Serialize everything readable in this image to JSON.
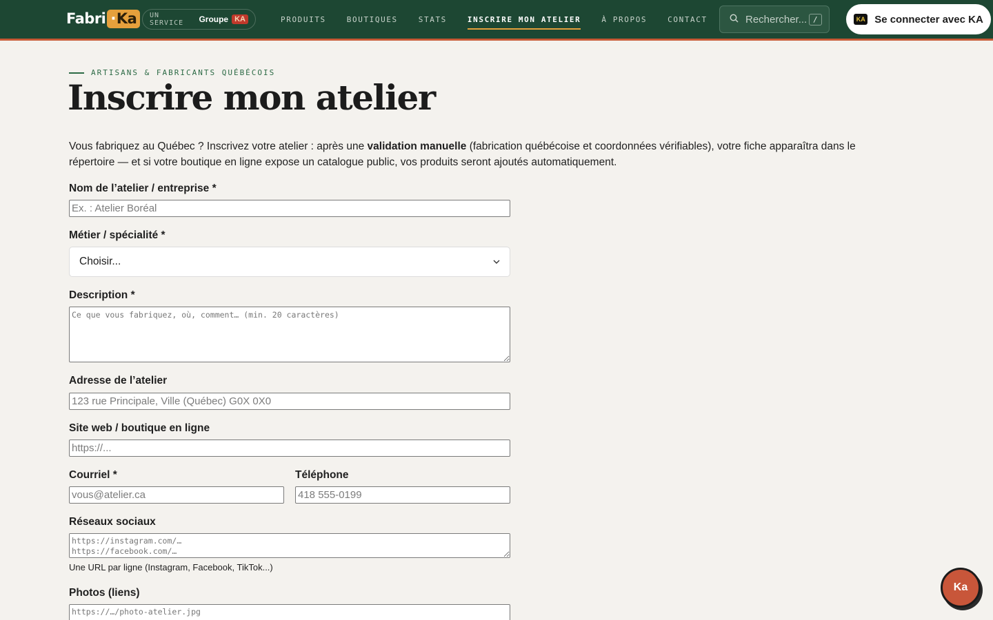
{
  "header": {
    "logo": {
      "text": "Fabri",
      "ka": "Ka"
    },
    "service": {
      "prefix": "UN SERVICE",
      "group": "Groupe",
      "badge": "KA"
    },
    "nav": [
      {
        "label": "PRODUITS"
      },
      {
        "label": "BOUTIQUES"
      },
      {
        "label": "STATS"
      },
      {
        "label": "INSCRIRE MON ATELIER",
        "active": true
      },
      {
        "label": "À PROPOS"
      },
      {
        "label": "CONTACT"
      }
    ],
    "search": {
      "placeholder": "Rechercher...",
      "shortcut": "/"
    },
    "login": {
      "chip": "KA",
      "label": "Se connecter avec KA"
    }
  },
  "page": {
    "eyebrow": "ARTISANS & FABRICANTS QUÉBÉCOIS",
    "title": "Inscrire mon atelier",
    "intro_before": "Vous fabriquez au Québec ? Inscrivez votre atelier : après une ",
    "intro_bold": "validation manuelle",
    "intro_after": " (fabrication québécoise et coordonnées vérifiables), votre fiche apparaîtra dans le répertoire — et si votre boutique en ligne expose un catalogue public, vos produits seront ajoutés automatiquement."
  },
  "form": {
    "name": {
      "label": "Nom de l’atelier / entreprise *",
      "placeholder": "Ex. : Atelier Boréal"
    },
    "trade": {
      "label": "Métier / spécialité *",
      "value": "Choisir..."
    },
    "description": {
      "label": "Description *",
      "placeholder": "Ce que vous fabriquez, où, comment… (min. 20 caractères)"
    },
    "address": {
      "label": "Adresse de l’atelier",
      "placeholder": "123 rue Principale, Ville (Québec) G0X 0X0"
    },
    "website": {
      "label": "Site web / boutique en ligne",
      "placeholder": "https://..."
    },
    "email": {
      "label": "Courriel *",
      "placeholder": "vous@atelier.ca"
    },
    "phone": {
      "label": "Téléphone",
      "placeholder": "418 555-0199"
    },
    "social": {
      "label": "Réseaux sociaux",
      "placeholder": "https://instagram.com/…\nhttps://facebook.com/…",
      "hint": "Une URL par ligne (Instagram, Facebook, TikTok...)"
    },
    "photos": {
      "label": "Photos (liens)",
      "placeholder": "https://…/photo-atelier.jpg"
    }
  },
  "fab": {
    "label": "Ka"
  },
  "colors": {
    "header_bg": "#1d4733",
    "accent": "#c85a36",
    "gold": "#e5a03c",
    "page_bg": "#f4f2ee"
  }
}
